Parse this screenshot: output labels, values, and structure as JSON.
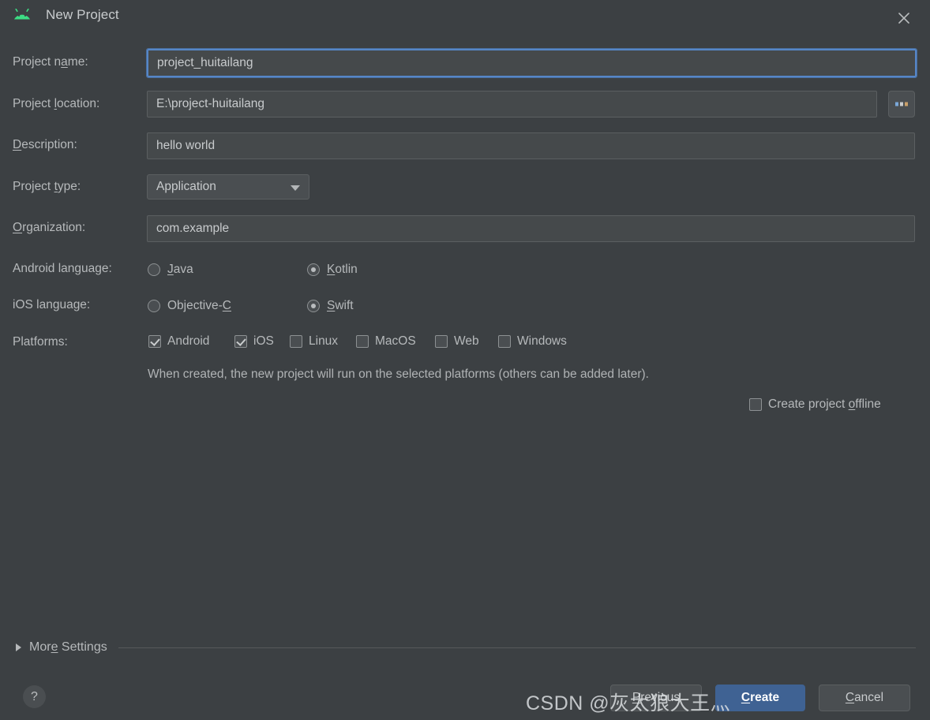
{
  "window": {
    "title": "New Project",
    "app_icon": "android-robot-icon",
    "close_icon": "close-icon",
    "accent_color": "#3f6293",
    "background_color": "#3c4043",
    "field_background": "#45494b",
    "focus_border_color": "#5686c7",
    "android_green": "#3ddc84"
  },
  "form": {
    "project_name": {
      "label_pre": "Project n",
      "label_accel": "a",
      "label_post": "me:",
      "value": "project_huitailang",
      "focused": true
    },
    "project_location": {
      "label_pre": "Project ",
      "label_accel": "l",
      "label_post": "ocation:",
      "value": "E:\\project-huitailang",
      "browse_button": "..."
    },
    "description": {
      "label_pre": "",
      "label_accel": "D",
      "label_post": "escription:",
      "value": "hello world"
    },
    "project_type": {
      "label_pre": "Project ",
      "label_accel": "t",
      "label_post": "ype:",
      "value": "Application",
      "options": [
        "Application"
      ]
    },
    "organization": {
      "label_pre": "",
      "label_accel": "O",
      "label_post": "rganization:",
      "value": "com.example"
    },
    "android_language": {
      "label": "Android language:",
      "options": [
        {
          "pre": "",
          "accel": "J",
          "post": "ava",
          "selected": false
        },
        {
          "pre": "",
          "accel": "K",
          "post": "otlin",
          "selected": true
        }
      ]
    },
    "ios_language": {
      "label": "iOS language:",
      "options": [
        {
          "pre": "Objective-",
          "accel": "C",
          "post": "",
          "selected": false
        },
        {
          "pre": "",
          "accel": "S",
          "post": "wift",
          "selected": true
        }
      ]
    },
    "platforms": {
      "label": "Platforms:",
      "options": [
        {
          "label": "Android",
          "checked": true
        },
        {
          "label": "iOS",
          "checked": true
        },
        {
          "label": "Linux",
          "checked": false
        },
        {
          "label": "MacOS",
          "checked": false
        },
        {
          "label": "Web",
          "checked": false
        },
        {
          "label": "Windows",
          "checked": false
        }
      ]
    },
    "hint": "When created, the new project will run on the selected platforms (others can be added later).",
    "create_offline": {
      "pre": "Create project ",
      "accel": "o",
      "post": "ffline",
      "checked": false
    }
  },
  "more_settings": {
    "pre": "Mor",
    "accel": "e",
    "post": " Settings",
    "expanded": false,
    "arrow_icon": "chevron-right-icon"
  },
  "footer": {
    "help_label": "?",
    "previous": {
      "pre": "",
      "accel": "P",
      "post": "revious"
    },
    "create": {
      "pre": "",
      "accel": "C",
      "post": "reate"
    },
    "cancel": {
      "pre": "",
      "accel": "C",
      "post": "ancel"
    }
  },
  "watermark": "CSDN @灰太狼大王灬"
}
